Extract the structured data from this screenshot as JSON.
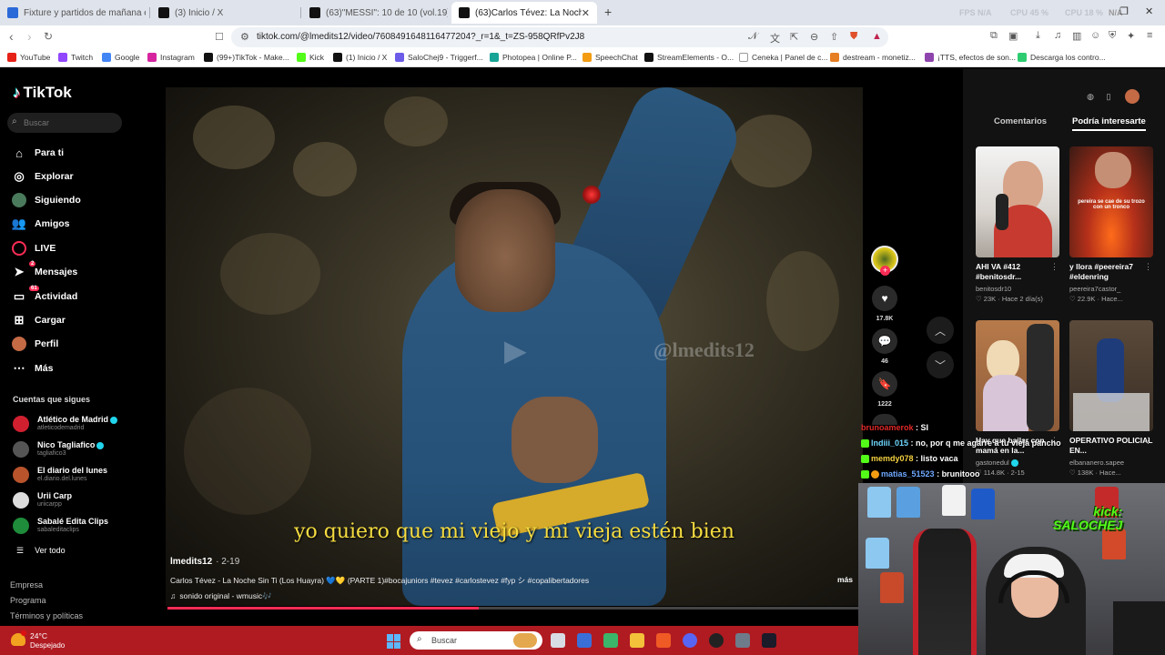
{
  "browser": {
    "tabs": [
      {
        "title": "Fixture y partidos de mañana en el F",
        "active": false
      },
      {
        "title": "(3) Inicio / X",
        "active": false
      },
      {
        "title": "(63)\"MESSI\": 10 de 10 (vol.19) #messi",
        "active": false
      },
      {
        "title": "(63)Carlos Tévez: La Noche Si",
        "active": true
      }
    ],
    "stats": {
      "fps_label": "FPS",
      "fps_value": "N/A",
      "cpu_label": "CPU",
      "cpu_value": "45 %",
      "gpu_label": "CPU",
      "gpu_value": "18 %",
      "extra_label": "N/A"
    },
    "url": "tiktok.com/@lmedits12/video/7608491648116477204?_r=1&_t=ZS-958QRfPv2J8",
    "bookmarks": [
      "YouTube",
      "Twitch",
      "Google",
      "Instagram",
      "(99+)TikTok - Make...",
      "Kick",
      "(1) Inicio / X",
      "SaloChej9 - Triggerf...",
      "Photopea | Online P...",
      "SpeechChat",
      "StreamElements - O...",
      "Ceneka | Panel de c...",
      "destream - monetiz...",
      "¡TTS, efectos de son...",
      "Descarga los contro..."
    ]
  },
  "tiktok": {
    "brand": "TikTok",
    "search_placeholder": "Buscar",
    "nav": [
      {
        "label": "Para ti",
        "icon": "home-icon"
      },
      {
        "label": "Explorar",
        "icon": "compass-icon"
      },
      {
        "label": "Siguiendo",
        "icon": "following-icon"
      },
      {
        "label": "Amigos",
        "icon": "friends-icon"
      },
      {
        "label": "LIVE",
        "icon": "live-icon"
      },
      {
        "label": "Mensajes",
        "icon": "messages-icon",
        "badge": "2"
      },
      {
        "label": "Actividad",
        "icon": "activity-icon",
        "badge": "61"
      },
      {
        "label": "Cargar",
        "icon": "upload-icon"
      },
      {
        "label": "Perfil",
        "icon": "profile-icon"
      },
      {
        "label": "Más",
        "icon": "more-icon"
      }
    ],
    "following_title": "Cuentas que sigues",
    "following": [
      {
        "name": "Atlético de Madrid",
        "handle": "atleticodemadrid",
        "verified": true
      },
      {
        "name": "Nico Tagliafico",
        "handle": "tagliafico3",
        "verified": true
      },
      {
        "name": "El diario del lunes",
        "handle": "el.diario.del.lunes",
        "verified": false
      },
      {
        "name": "Urii Carp",
        "handle": "uriicarpp",
        "verified": false
      },
      {
        "name": "Sabalé Edita Clips",
        "handle": "sabaleditaclips",
        "verified": false
      }
    ],
    "see_all": "Ver todo",
    "footer": [
      "Empresa",
      "Programa",
      "Términos y políticas"
    ]
  },
  "video": {
    "watermark": "@lmedits12",
    "subtitle": "yo quiero que mi viejo y mi vieja estén bien",
    "author": "lmedits12",
    "date": "· 2-19",
    "caption": "Carlos Tévez - La Noche Sin Ti (Los Huayra) 💙💛 (PARTE 1)#bocajuniors #tevez #carlostevez #fyp シ #copalibertadores",
    "sound": "sonido original - wmusic🎶",
    "more": "más",
    "progress": 0.45,
    "likes": "17.8K",
    "comments": "46",
    "saves": "1222"
  },
  "right_panel": {
    "tab_comments": "Comentarios",
    "tab_interest": "Podría interesarte",
    "cards": [
      {
        "title": "AHI VA #412 #benitosdr...",
        "user": "benitosdr10",
        "stats": "♡ 23K · Hace 2 día(s)",
        "overlay": ""
      },
      {
        "title": "y llora #peereira7 #eldenring",
        "user": "peereira7castor_",
        "stats": "♡ 22.9K · Hace...",
        "overlay": "pereira se cae de su trozo con un tronco"
      },
      {
        "title": "Hay que bailar con mamá en la...",
        "user": "gastonedul",
        "stats": "♡ 114.8K · 2-15",
        "overlay": ""
      },
      {
        "title": "OPERATIVO POLICIAL EN...",
        "user": "elbananero.sapee",
        "stats": "♡ 138K · Hace...",
        "overlay": ""
      }
    ]
  },
  "chat": [
    {
      "user": "brunoamerok",
      "message": "SI"
    },
    {
      "user": "lndiii_015",
      "message": "no, por q me agarre a tu vieja pancho"
    },
    {
      "user": "memdy078",
      "message": "listo vaca"
    },
    {
      "user": "matias_51523",
      "message": "brunitooo"
    }
  ],
  "webcam": {
    "logo_line1": "kick:",
    "logo_line2": "SALOCHEJ"
  },
  "taskbar": {
    "temperature": "24°C",
    "weather": "Despejado",
    "search": "Buscar",
    "badge": "1"
  },
  "colors": {
    "accent": "#fe2c55",
    "taskbar": "#b01b22",
    "subtitle": "#f6dd40",
    "kick": "#53fc18"
  }
}
